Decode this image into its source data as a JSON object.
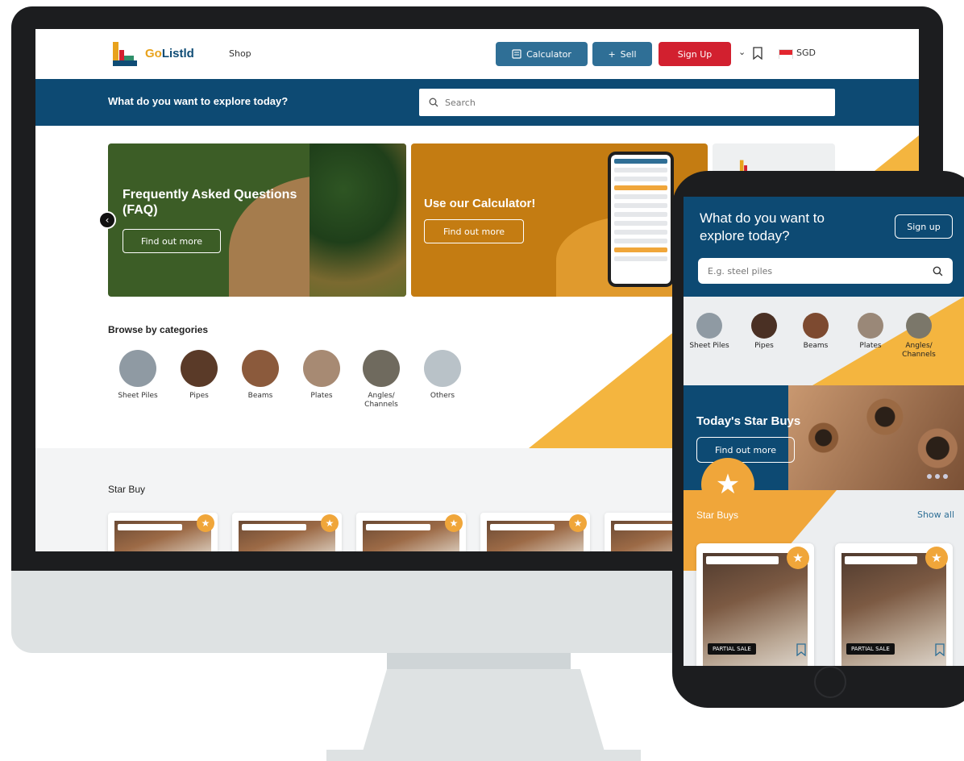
{
  "desktop": {
    "logo": {
      "go": "Go",
      "rest": "Listld"
    },
    "nav": {
      "shop": "Shop"
    },
    "header": {
      "calculator_label": "Calculator",
      "sell_label": "Sell",
      "signup_label": "Sign Up",
      "currency": "SGD"
    },
    "search_band": {
      "title": "What do you want to explore today?",
      "search_placeholder": "Search"
    },
    "banners": {
      "faq": {
        "title": "Frequently Asked Questions (FAQ)",
        "button": "Find out more"
      },
      "calculator": {
        "title": "Use our Calculator!",
        "button": "Find out more"
      }
    },
    "categories": {
      "title": "Browse by categories",
      "items": [
        {
          "label": "Sheet Piles",
          "color": "#8f9aa3"
        },
        {
          "label": "Pipes",
          "color": "#5a3a28"
        },
        {
          "label": "Beams",
          "color": "#8b5a3c"
        },
        {
          "label": "Plates",
          "color": "#a78a73"
        },
        {
          "label": "Angles/ Channels",
          "color": "#6f6a5e"
        },
        {
          "label": "Others",
          "color": "#b9c2c8"
        }
      ]
    },
    "star_buy": {
      "title": "Star Buy"
    }
  },
  "mobile": {
    "title": "What do you want to explore today?",
    "signup_label": "Sign up",
    "search_placeholder": "E.g. steel piles",
    "categories": [
      {
        "label": "Sheet Piles",
        "color": "#8f9aa3"
      },
      {
        "label": "Pipes",
        "color": "#4a3024"
      },
      {
        "label": "Beams",
        "color": "#7d4a30"
      },
      {
        "label": "Plates",
        "color": "#9a8878"
      },
      {
        "label": "Angles/ Channels",
        "color": "#7b776a"
      }
    ],
    "hero": {
      "title": "Today's Star Buys",
      "button": "Find out more"
    },
    "star_buys": {
      "title": "Star Buys",
      "show_all": "Show all"
    },
    "products": [
      {
        "tag": "PARTIAL SALE"
      },
      {
        "tag": "PARTIAL SALE"
      }
    ]
  },
  "colors": {
    "brand_blue": "#0d4a73",
    "accent_orange": "#f0a63a",
    "signup_red": "#d2202f",
    "button_blue": "#2f6f96"
  }
}
